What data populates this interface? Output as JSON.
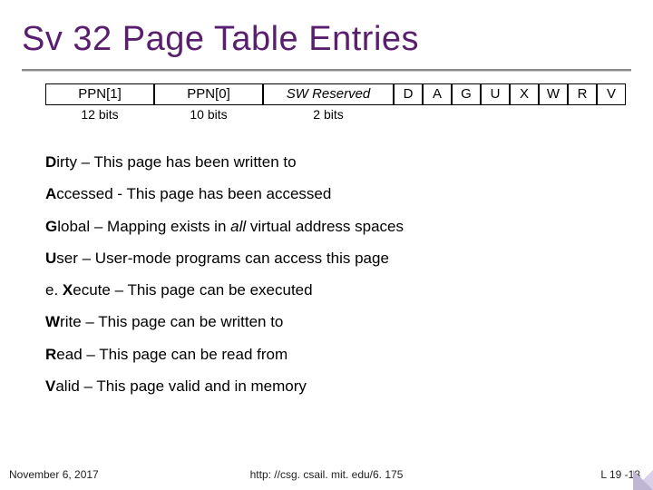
{
  "title": "Sv 32 Page Table Entries",
  "pte": {
    "fields": {
      "ppn1": "PPN[1]",
      "ppn0": "PPN[0]",
      "swres": "SW Reserved",
      "bits": [
        "D",
        "A",
        "G",
        "U",
        "X",
        "W",
        "R",
        "V"
      ]
    },
    "captions": {
      "ppn1": "12 bits",
      "ppn0": "10 bits",
      "swres": "2 bits"
    }
  },
  "defs": [
    {
      "letter": "D",
      "word_rest": "irty",
      "desc": " – This page has been written to"
    },
    {
      "letter": "A",
      "word_rest": "ccessed",
      "desc": " - This page has been accessed"
    },
    {
      "letter": "G",
      "word_rest": "lobal",
      "desc_pre": " – Mapping exists in ",
      "desc_ital": "all",
      "desc_post": " virtual address spaces"
    },
    {
      "letter": "U",
      "word_rest": "ser",
      "desc": " – User-mode programs can access this page"
    },
    {
      "word_pre": "e. ",
      "letter": "X",
      "word_rest": "ecute",
      "desc": " – This page can be executed"
    },
    {
      "letter": "W",
      "word_rest": "rite",
      "desc": " – This page can be written to"
    },
    {
      "letter": "R",
      "word_rest": "ead",
      "desc": " – This page can be read from"
    },
    {
      "letter": "V",
      "word_rest": "alid",
      "desc": " – This page valid and in memory"
    }
  ],
  "footer": {
    "date": "November 6, 2017",
    "link": "http: //csg. csail. mit. edu/6. 175",
    "page": "L 19 -18"
  }
}
